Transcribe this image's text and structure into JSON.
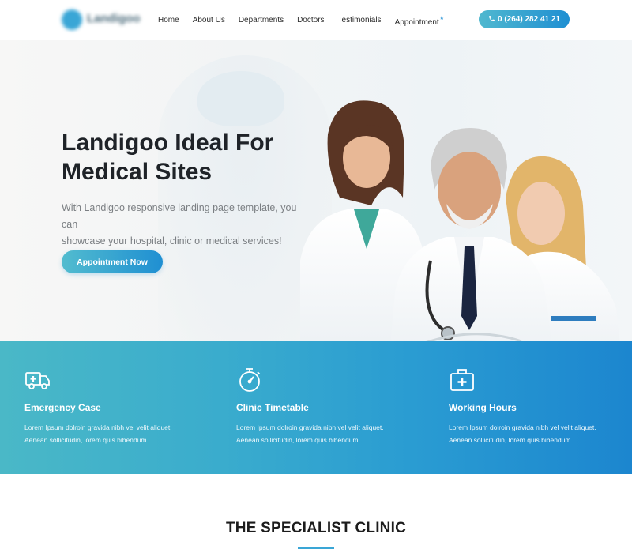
{
  "header": {
    "logo_text": "Landigoo",
    "nav": [
      "Home",
      "About Us",
      "Departments",
      "Doctors",
      "Testimonials",
      "Appointment"
    ],
    "nav_marker": "*",
    "phone": "0 (264) 282 41 21",
    "phone_icon": "phone-icon"
  },
  "hero": {
    "title_line1": "Landigoo Ideal For",
    "title_line2": "Medical Sites",
    "subtitle_line1": "With Landigoo responsive landing page template, you can",
    "subtitle_line2": "showcase your hospital, clinic or medical services!",
    "cta": "Appointment Now"
  },
  "features": [
    {
      "icon": "ambulance-icon",
      "title": "Emergency Case",
      "text_line1": "Lorem Ipsum dolroin gravida nibh vel velit aliquet.",
      "text_line2": "Aenean sollicitudin, lorem quis bibendum.."
    },
    {
      "icon": "stopwatch-icon",
      "title": "Clinic Timetable",
      "text_line1": "Lorem Ipsum dolroin gravida nibh vel velit aliquet.",
      "text_line2": "Aenean sollicitudin, lorem quis bibendum.."
    },
    {
      "icon": "medical-kit-icon",
      "title": "Working Hours",
      "text_line1": "Lorem Ipsum dolroin gravida nibh vel velit aliquet.",
      "text_line2": "Aenean sollicitudin, lorem quis bibendum.."
    }
  ],
  "section": {
    "title": "THE SPECIALIST CLINIC"
  },
  "colors": {
    "accent": "#1f8fd2",
    "accent_light": "#4ab8c7",
    "heading": "#1f2328"
  }
}
